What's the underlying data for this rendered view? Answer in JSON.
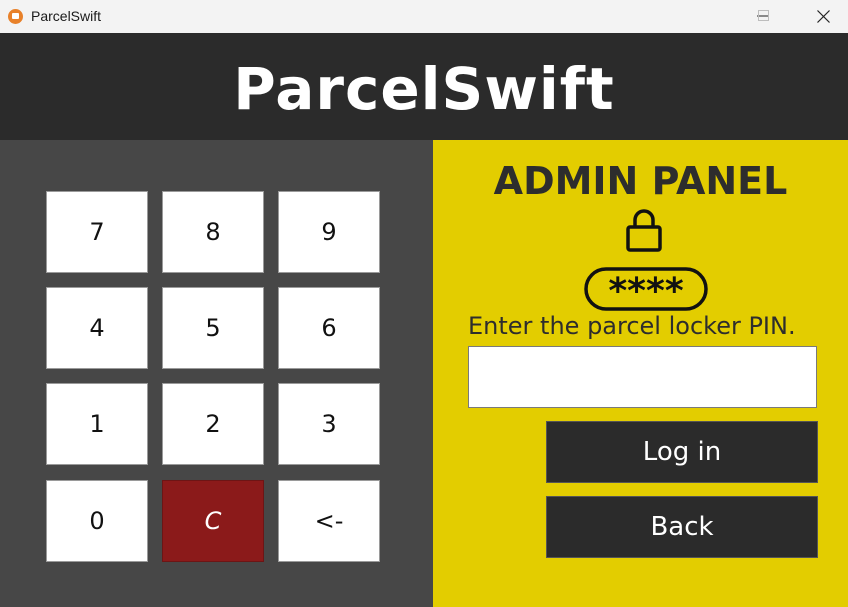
{
  "window": {
    "title": "ParcelSwift",
    "icon": "parcelswift-app-icon",
    "controls": [
      "minimize-icon",
      "maximize-icon",
      "close-icon"
    ]
  },
  "header": {
    "brand": "ParcelSwift"
  },
  "keypad": {
    "keys": [
      "7",
      "8",
      "9",
      "4",
      "5",
      "6",
      "1",
      "2",
      "3",
      "0",
      "C",
      "<-"
    ]
  },
  "admin": {
    "title": "ADMIN PANEL",
    "lock_icon": "padlock-icon",
    "pin_icon": "password-asterisks-icon",
    "pin_symbol": "****",
    "prompt": "Enter the parcel locker PIN.",
    "pin_value": "",
    "login_label": "Log in",
    "back_label": "Back"
  },
  "colors": {
    "header_bg": "#2b2b2b",
    "keypad_bg": "#474747",
    "admin_bg": "#e3cd00",
    "clear_key": "#8b1a1a",
    "button_bg": "#2b2b2b"
  }
}
